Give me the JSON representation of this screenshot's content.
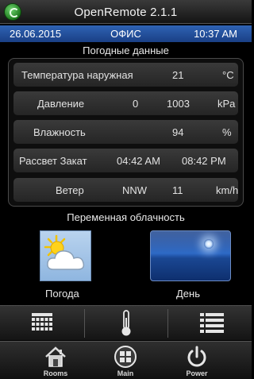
{
  "app": {
    "title": "OpenRemote 2.1.1"
  },
  "status": {
    "date": "26.06.2015",
    "location": "ОФИС",
    "time": "10:37 AM"
  },
  "weather_section": {
    "title": "Погодные данные",
    "rows": [
      {
        "label": "Температура наружная",
        "value": "21",
        "unit": "°C"
      },
      {
        "label": "Давление",
        "value": "0",
        "value2": "1003",
        "unit": "kPa"
      },
      {
        "label": "Влажность",
        "value": "94",
        "unit": "%"
      },
      {
        "label": "Рассвет Закат",
        "value": "04:42 AM",
        "value2": "08:42 PM"
      },
      {
        "label": "Ветер",
        "value": "NNW",
        "value2": "11",
        "unit": "km/h"
      }
    ]
  },
  "condition": "Переменная облачность",
  "tiles": {
    "weather_label": "Погода",
    "day_label": "День"
  },
  "icon_bar": {
    "icons": [
      "calendar-grid-icon",
      "thermometer-icon",
      "list-icon"
    ]
  },
  "nav": [
    {
      "label": "Rooms",
      "icon": "house-icon"
    },
    {
      "label": "Main",
      "icon": "grid-circle-icon"
    },
    {
      "label": "Power",
      "icon": "power-icon"
    }
  ],
  "colors": {
    "status_bar": "#2a5aa8",
    "accent_green": "#3aa83a"
  }
}
